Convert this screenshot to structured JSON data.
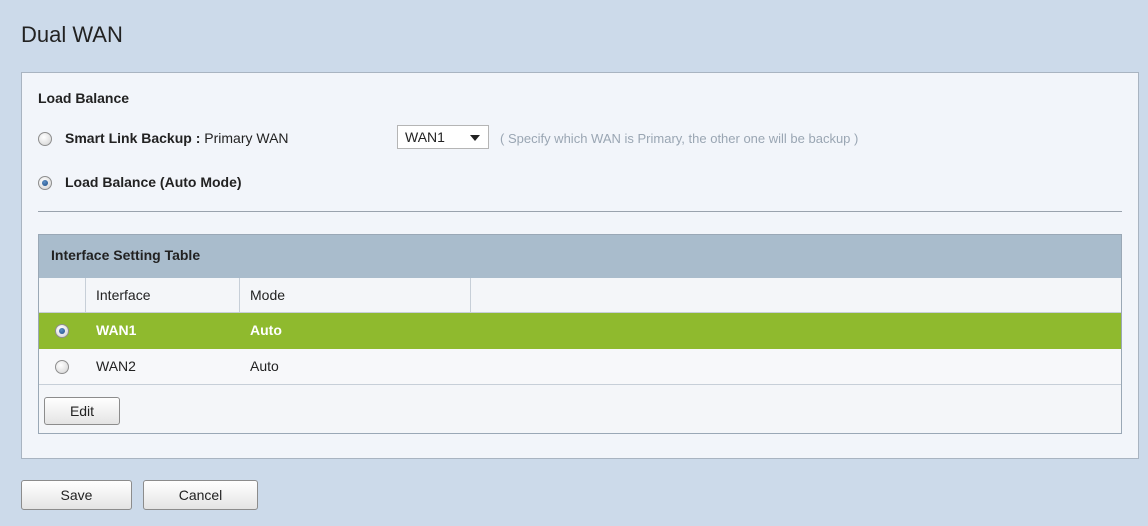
{
  "page": {
    "title": "Dual WAN"
  },
  "load_balance": {
    "heading": "Load Balance",
    "smart_link_label": "Smart Link Backup :",
    "primary_wan_label": "Primary WAN",
    "primary_wan_value": "WAN1",
    "hint": "( Specify which WAN is Primary, the other one will be backup )",
    "auto_mode_label": "Load Balance (Auto Mode)",
    "selected_option": "Load Balance (Auto Mode)"
  },
  "interface_table": {
    "title": "Interface Setting Table",
    "columns": [
      "Interface",
      "Mode"
    ],
    "rows": [
      {
        "interface": "WAN1",
        "mode": "Auto",
        "selected": true
      },
      {
        "interface": "WAN2",
        "mode": "Auto",
        "selected": false
      }
    ],
    "edit_label": "Edit"
  },
  "actions": {
    "save_label": "Save",
    "cancel_label": "Cancel"
  },
  "colors": {
    "page_bg": "#ccdaea",
    "panel_bg": "#f2f5fa",
    "table_header_bg": "#a9bccc",
    "selected_row_bg": "#8fba2e"
  }
}
